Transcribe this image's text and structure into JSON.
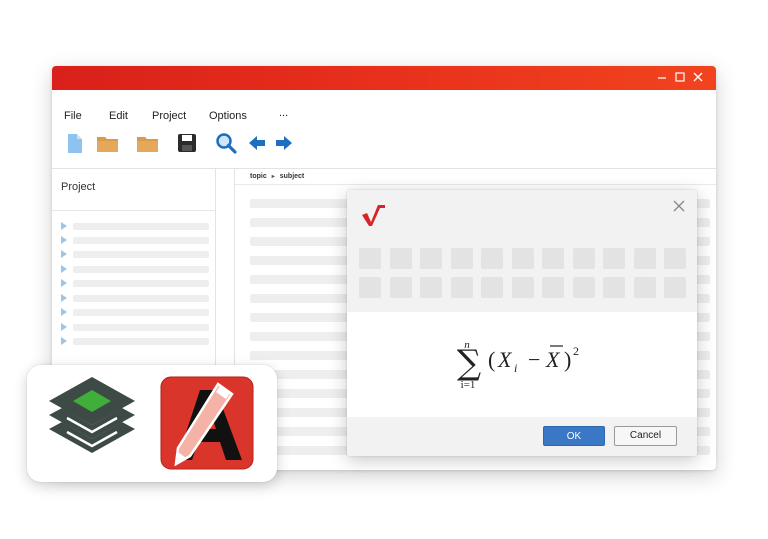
{
  "window": {
    "controls": [
      "minimize-icon",
      "maximize-icon",
      "close-icon"
    ],
    "accent_color": "#e8301c"
  },
  "menu": {
    "items": [
      "File",
      "Edit",
      "Project",
      "Options",
      "..."
    ]
  },
  "toolbar": {
    "icons": [
      "new-document-icon",
      "open-folder-icon",
      "folder-icon",
      "save-icon",
      "search-icon",
      "back-arrow-icon",
      "forward-arrow-icon"
    ]
  },
  "sidebar": {
    "title": "Project"
  },
  "breadcrumb": {
    "items": [
      "topic",
      "subject"
    ],
    "separator": "▸"
  },
  "dialog": {
    "logo": "mathtype-logo-icon",
    "close": "close-icon",
    "formula": {
      "upper_limit": "n",
      "lower_limit": "i=1",
      "operator": "∑",
      "open_paren": "(",
      "term": "X",
      "subscript": "i",
      "minus": "−",
      "mean": "X",
      "close_paren": ")",
      "exponent": "2"
    },
    "ok_label": "OK",
    "cancel_label": "Cancel",
    "ok_color": "#3a77c4"
  },
  "badges": {
    "icons": [
      "stacked-layers-app-icon",
      "red-a-pencil-app-icon"
    ],
    "colors": {
      "layers": "#3e4a45",
      "layers_top": "#3fae3a",
      "a_app": "#d9352a"
    }
  }
}
